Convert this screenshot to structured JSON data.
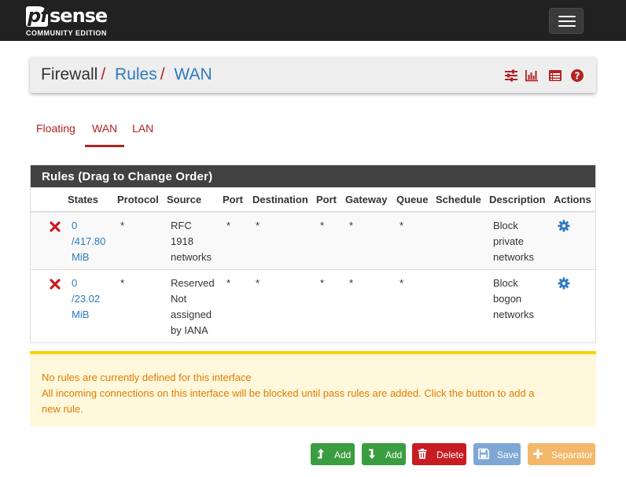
{
  "brand": {
    "pf": "pf",
    "sense": "sense",
    "edition": "COMMUNITY EDITION"
  },
  "breadcrumb": {
    "root": "Firewall",
    "sep": "/",
    "level2": "Rules",
    "level3": "WAN"
  },
  "header_icons": [
    "sliders-icon",
    "bar-chart-icon",
    "table-list-icon",
    "help-icon"
  ],
  "tabs": [
    {
      "label": "Floating",
      "active": false
    },
    {
      "label": "WAN",
      "active": true
    },
    {
      "label": "LAN",
      "active": false
    }
  ],
  "rules_panel": {
    "title": "Rules (Drag to Change Order)",
    "columns": [
      "States",
      "Protocol",
      "Source",
      "Port",
      "Destination",
      "Port",
      "Gateway",
      "Queue",
      "Schedule",
      "Description",
      "Actions"
    ],
    "rows": [
      {
        "states_count": "0",
        "states_bytes": "/417.80",
        "states_unit": "MiB",
        "protocol": "*",
        "source": [
          "RFC",
          "1918",
          "networks"
        ],
        "port": "*",
        "destination": "*",
        "dest_port": "*",
        "gateway": "*",
        "queue": "*",
        "schedule": "",
        "description": [
          "Block",
          "private",
          "networks"
        ]
      },
      {
        "states_count": "0",
        "states_bytes": "/23.02",
        "states_unit": "MiB",
        "protocol": "*",
        "source": [
          "Reserved",
          "Not",
          "assigned",
          "by IANA"
        ],
        "port": "*",
        "destination": "*",
        "dest_port": "*",
        "gateway": "*",
        "queue": "*",
        "schedule": "",
        "description": [
          "Block",
          "bogon",
          "networks"
        ]
      }
    ]
  },
  "alert": {
    "line1": "No rules are currently defined for this interface",
    "line2": "All incoming connections on this interface will be blocked until pass rules are added. Click the button to add a",
    "line3": "new rule."
  },
  "buttons": {
    "add_top": "Add",
    "add_bottom": "Add",
    "delete": "Delete",
    "save": "Save",
    "separator": "Separator"
  },
  "colors": {
    "navbar": "#212121",
    "accent_red": "#b22222",
    "link_blue": "#2c7bbf",
    "alert_text": "#e07b00",
    "alert_bg": "#fff8dc",
    "btn_green": "#3a9d3f",
    "btn_red": "#c71c22",
    "btn_blue": "#7ea7d6",
    "btn_orange": "#f4b86a"
  }
}
